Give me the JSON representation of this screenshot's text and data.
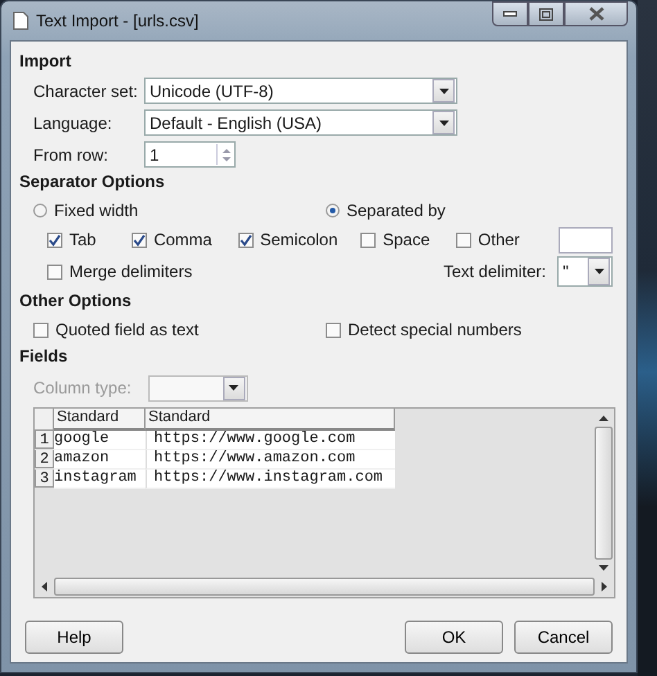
{
  "window": {
    "title": "Text Import - [urls.csv]"
  },
  "import": {
    "heading": "Import",
    "character_set": {
      "label": "Character set:",
      "value": "Unicode (UTF-8)"
    },
    "language": {
      "label": "Language:",
      "value": "Default - English (USA)"
    },
    "from_row": {
      "label": "From row:",
      "value": "1"
    }
  },
  "separator_options": {
    "heading": "Separator Options",
    "modes": [
      {
        "label": "Fixed width",
        "selected": false
      },
      {
        "label": "Separated by",
        "selected": true
      }
    ],
    "separators": [
      {
        "label": "Tab",
        "checked": true
      },
      {
        "label": "Comma",
        "checked": true
      },
      {
        "label": "Semicolon",
        "checked": true
      },
      {
        "label": "Space",
        "checked": false
      },
      {
        "label": "Other",
        "checked": false
      }
    ],
    "merge_delimiters": {
      "label": "Merge delimiters",
      "checked": false
    },
    "text_delimiter": {
      "label": "Text delimiter:",
      "value": "\""
    }
  },
  "other_options": {
    "heading": "Other Options",
    "options": [
      {
        "label": "Quoted field as text",
        "checked": false
      },
      {
        "label": "Detect special numbers",
        "checked": false
      }
    ]
  },
  "fields": {
    "heading": "Fields",
    "column_type": {
      "label": "Column type:",
      "disabled": true
    },
    "table": {
      "columns": [
        "Standard",
        "Standard"
      ],
      "rows": [
        {
          "number": "1",
          "cells": [
            "google",
            "https://www.google.com"
          ]
        },
        {
          "number": "2",
          "cells": [
            "amazon",
            "https://www.amazon.com"
          ]
        },
        {
          "number": "3",
          "cells": [
            "instagram",
            "https://www.instagram.com"
          ]
        }
      ]
    }
  },
  "buttons": [
    {
      "label": "Help"
    },
    {
      "label": "OK"
    },
    {
      "label": "Cancel"
    }
  ]
}
